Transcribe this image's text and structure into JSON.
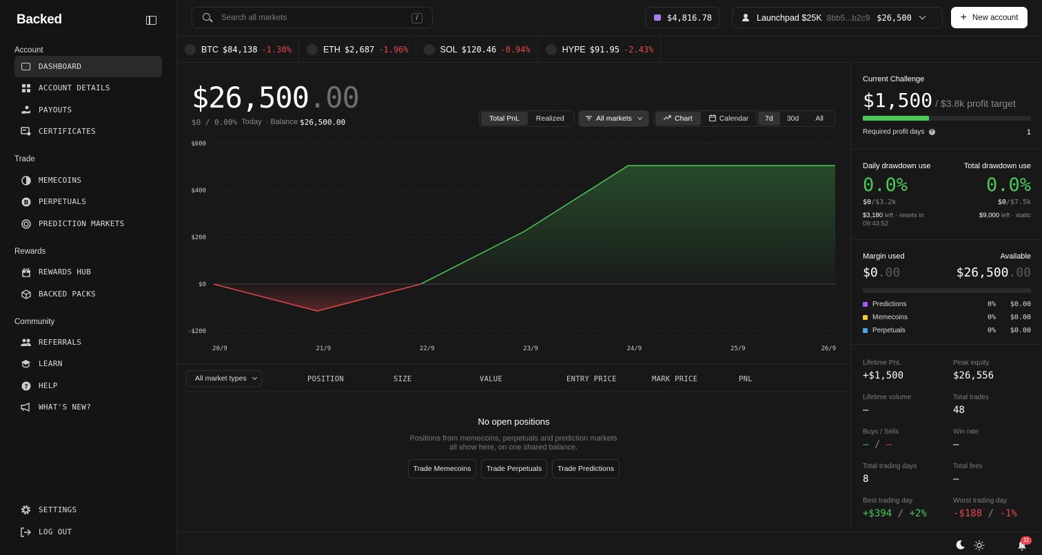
{
  "sidebar": {
    "logo": "Backed",
    "sections": [
      {
        "title": "Account",
        "items": [
          "DASHBOARD",
          "ACCOUNT DETAILS",
          "PAYOUTS",
          "CERTIFICATES"
        ]
      },
      {
        "title": "Trade",
        "items": [
          "MEMECOINS",
          "PERPETUALS",
          "PREDICTION MARKETS"
        ]
      },
      {
        "title": "Rewards",
        "items": [
          "REWARDS HUB",
          "BACKED PACKS"
        ]
      },
      {
        "title": "Community",
        "items": [
          "REFERRALS",
          "LEARN",
          "HELP",
          "WHAT'S NEW?"
        ]
      }
    ],
    "footer": [
      "SETTINGS",
      "LOG OUT"
    ],
    "active_item": "DASHBOARD"
  },
  "topbar": {
    "search_placeholder": "Search all markets",
    "search_shortcut": "/",
    "wallet_balance": "$4,816.78",
    "account_name": "Launchpad $25K",
    "account_id": "8bb5...b2c9",
    "account_balance": "$26,500",
    "new_account_label": "New account"
  },
  "ticker": [
    {
      "symbol": "BTC",
      "price": "$84,138",
      "change": "-1.30%"
    },
    {
      "symbol": "ETH",
      "price": "$2,687",
      "change": "-1.96%"
    },
    {
      "symbol": "SOL",
      "price": "$120.46",
      "change": "-0.94%"
    },
    {
      "symbol": "HYPE",
      "price": "$91.95",
      "change": "-2.43%"
    }
  ],
  "overview": {
    "balance_int": "$26,500",
    "balance_dec": ".00",
    "pnl_today": "$0 / 0.00%",
    "today_label": "Today",
    "balance_label": "· Balance",
    "balance_value": "$26,500.00",
    "pnl_tabs": [
      "Total PnL",
      "Realized"
    ],
    "market_filter": "All markets",
    "view_tabs": [
      "Chart",
      "Calendar"
    ],
    "range_tabs": [
      "7d",
      "30d",
      "All"
    ]
  },
  "chart_data": {
    "type": "area",
    "x": [
      "20/9",
      "21/9",
      "22/9",
      "23/9",
      "24/9",
      "25/9",
      "26/9"
    ],
    "values": [
      0,
      -115,
      0,
      225,
      505,
      505,
      505
    ],
    "yticks": [
      "$600",
      "$400",
      "$200",
      "$0",
      "-$200"
    ],
    "ylim": [
      -200,
      600
    ],
    "colors": {
      "positive": "#4cc95a",
      "negative": "#e5484d"
    },
    "grid": true
  },
  "positions": {
    "filter_label": "All market types",
    "columns": [
      "POSITION",
      "SIZE",
      "VALUE",
      "ENTRY PRICE",
      "MARK PRICE",
      "PNL"
    ],
    "empty_title": "No open positions",
    "empty_desc": "Positions from memecoins, perpetuals and prediction markets all show here, on one shared balance.",
    "buttons": [
      "Trade Memecoins",
      "Trade Perpetuals",
      "Trade Predictions"
    ]
  },
  "challenge": {
    "title": "Current Challenge",
    "profit": "$1,500",
    "target": "/ $3.8k profit target",
    "progress": 0.395,
    "req_days_label": "Required profit days",
    "req_days_value": "1"
  },
  "drawdown": {
    "daily_label": "Daily drawdown use",
    "daily_pct": "0.0%",
    "daily_used": "$0",
    "daily_limit": "/$3.2k",
    "daily_left": "$3,180",
    "daily_left_text": "left · resets in",
    "daily_timer": "09:43:52",
    "total_label": "Total drawdown use",
    "total_pct": "0.0%",
    "total_used": "$0",
    "total_limit": "/$7.5k",
    "total_left": "$9,000",
    "total_left_text": "left · static"
  },
  "margin": {
    "used_label": "Margin used",
    "used_int": "$0",
    "used_dec": ".00",
    "avail_label": "Available",
    "avail_int": "$26,500",
    "avail_dec": ".00",
    "legend": [
      {
        "name": "Predictions",
        "pct": "0%",
        "value": "$0.00",
        "color": "#a855f7"
      },
      {
        "name": "Memecoins",
        "pct": "0%",
        "value": "$0.00",
        "color": "#f5c542"
      },
      {
        "name": "Perpetuals",
        "pct": "0%",
        "value": "$0.00",
        "color": "#4aa8e8"
      }
    ]
  },
  "stats": {
    "lifetime_pnl_label": "Lifetime PnL",
    "lifetime_pnl": "+$1,500",
    "peak_equity_label": "Peak equity",
    "peak_equity": "$26,556",
    "lifetime_volume_label": "Lifetime volume",
    "lifetime_volume": "–",
    "total_trades_label": "Total trades",
    "total_trades": "48",
    "buys_sells_label": "Buys / Sells",
    "buys": "–",
    "sep": "/",
    "sells": "–",
    "win_rate_label": "Win rate",
    "win_rate": "–",
    "trading_days_label": "Total trading days",
    "trading_days": "8",
    "fees_label": "Total fees",
    "fees": "–",
    "best_day_label": "Best trading day",
    "best_day": "+$394",
    "best_day_pct": "+2%",
    "worst_day_label": "Worst trading day",
    "worst_day": "-$188",
    "worst_day_pct": "-1%"
  },
  "footer": {
    "notifications": "11"
  }
}
